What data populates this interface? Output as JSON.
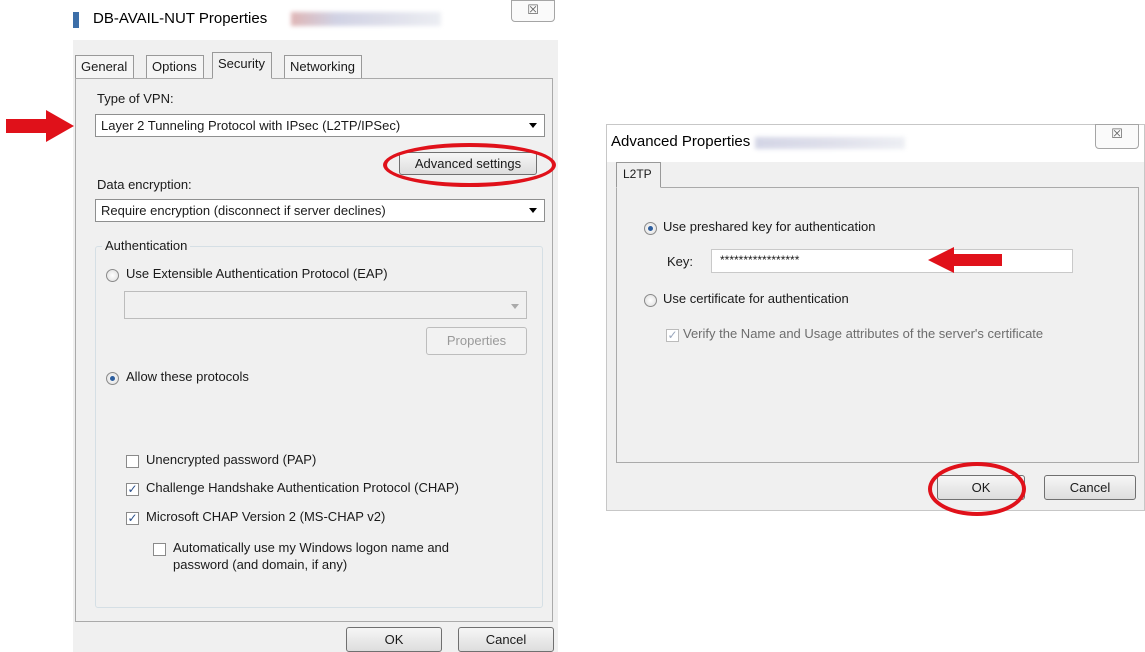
{
  "left_dialog": {
    "title": "DB-AVAIL-NUT Properties",
    "close_symbol": "☒",
    "tabs": [
      {
        "label": "General"
      },
      {
        "label": "Options"
      },
      {
        "label": "Security"
      },
      {
        "label": "Networking"
      }
    ],
    "active_tab": "Security",
    "vpn_type": {
      "label": "Type of VPN:",
      "value": "Layer 2 Tunneling Protocol with IPsec (L2TP/IPSec)"
    },
    "advanced_settings_label": "Advanced settings",
    "data_encryption": {
      "label": "Data encryption:",
      "value": "Require encryption (disconnect if server declines)"
    },
    "authentication": {
      "legend": "Authentication",
      "eap_label": "Use Extensible Authentication Protocol (EAP)",
      "eap_selected": false,
      "eap_combo_value": "",
      "properties_label": "Properties",
      "allow_label": "Allow these protocols",
      "allow_selected": true,
      "protocols": [
        {
          "label": "Unencrypted password (PAP)",
          "checked": false
        },
        {
          "label": "Challenge Handshake Authentication Protocol (CHAP)",
          "checked": true
        },
        {
          "label": "Microsoft CHAP Version 2 (MS-CHAP v2)",
          "checked": true
        }
      ],
      "auto_logon": {
        "line1": "Automatically use my Windows logon name and",
        "line2": "password (and domain, if any)",
        "checked": false
      }
    },
    "ok_label": "OK",
    "cancel_label": "Cancel"
  },
  "right_dialog": {
    "title": "Advanced Properties",
    "close_symbol": "☒",
    "tab": "L2TP",
    "preshared": {
      "label": "Use preshared key for authentication",
      "selected": true,
      "key_label": "Key:",
      "key_value": "*****************"
    },
    "certificate": {
      "label": "Use certificate for authentication",
      "selected": false,
      "verify_label": "Verify the Name and Usage attributes of the server's certificate",
      "verify_checked": true
    },
    "ok_label": "OK",
    "cancel_label": "Cancel"
  },
  "colors": {
    "annotation_red": "#e0111a",
    "radio_accent": "#2d5e9e"
  }
}
